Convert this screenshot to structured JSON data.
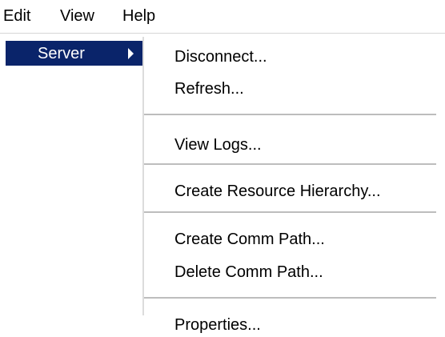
{
  "menubar": {
    "items": [
      "Edit",
      "View",
      "Help"
    ]
  },
  "menu": {
    "active_item": "Server",
    "submenu_indicator_icon": "chevron-right-icon",
    "highlight_color": "#0a246a",
    "submenu": [
      {
        "label": "Disconnect..."
      },
      {
        "label": "Refresh..."
      },
      {
        "label": "View Logs..."
      },
      {
        "label": "Create Resource Hierarchy..."
      },
      {
        "label": "Create Comm Path..."
      },
      {
        "label": "Delete Comm Path..."
      },
      {
        "label": "Properties..."
      }
    ]
  }
}
